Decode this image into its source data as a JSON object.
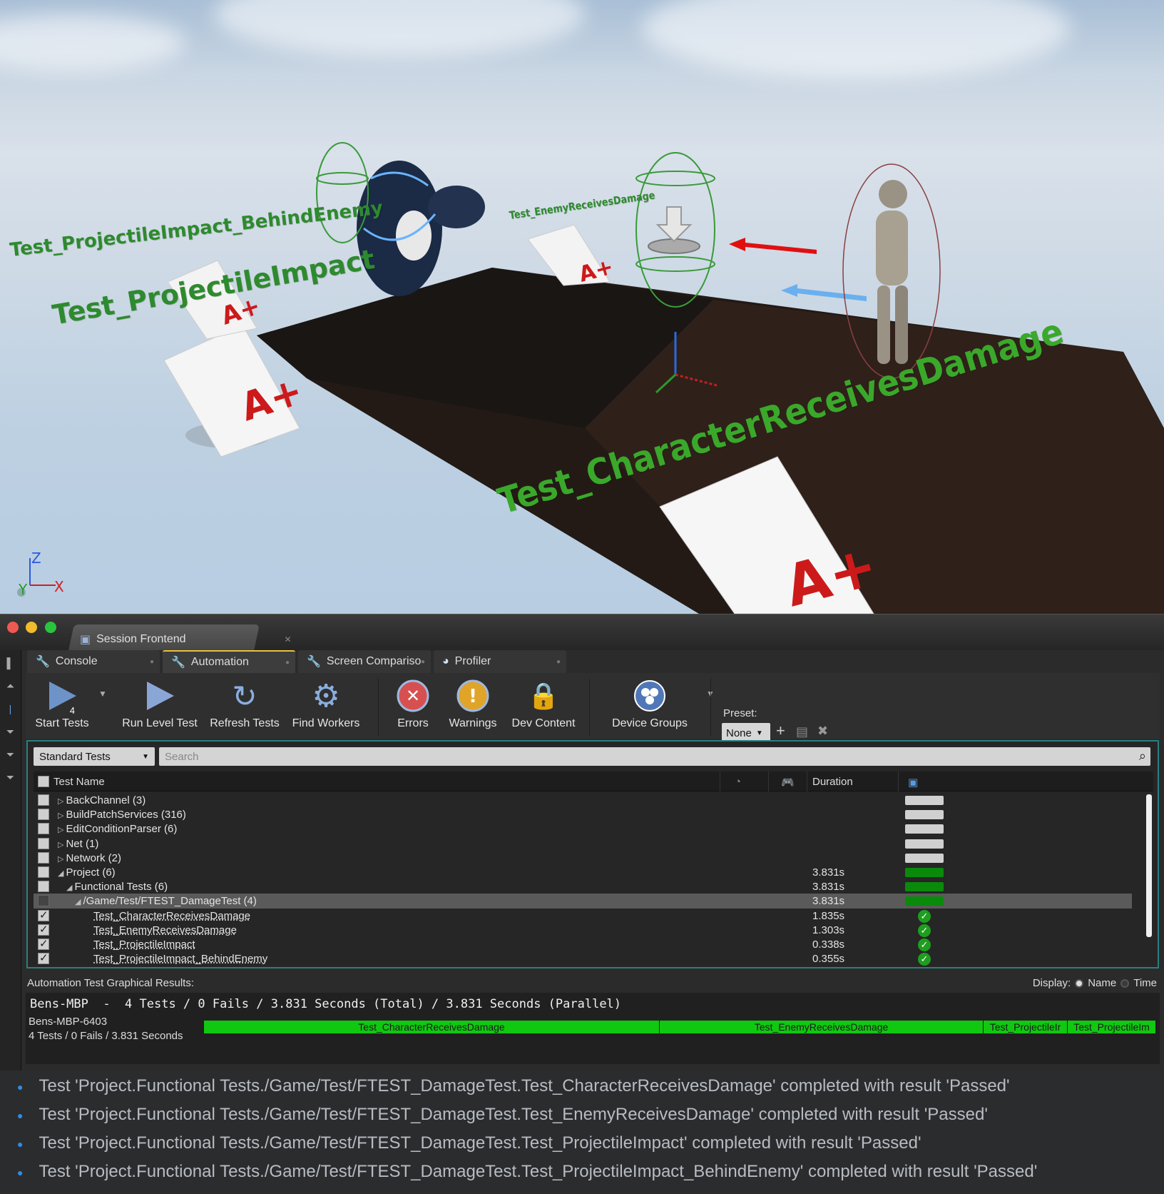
{
  "viewport": {
    "world_labels": [
      "Test_ProjectileImpact_BehindEnemy",
      "Test_ProjectileImpact",
      "Test_EnemyReceivesDamage",
      "Test_CharacterReceivesDamage"
    ],
    "axis": {
      "z": "Z",
      "y": "Y",
      "x": "X"
    }
  },
  "window": {
    "major_tab": "Session Frontend",
    "subtabs": [
      "Console",
      "Automation",
      "Screen Compariso",
      "Profiler"
    ],
    "toolbar": {
      "start_tests": "Start Tests",
      "start_count": "4",
      "run_level_test": "Run Level Test",
      "refresh_tests": "Refresh Tests",
      "find_workers": "Find Workers",
      "errors": "Errors",
      "warnings": "Warnings",
      "dev_content": "Dev Content",
      "device_groups": "Device Groups",
      "preset_label": "Preset:",
      "preset_value": "None"
    },
    "filter": {
      "selected": "Standard Tests",
      "search_placeholder": "Search"
    },
    "columns": {
      "name": "Test Name",
      "duration": "Duration"
    },
    "rows": [
      {
        "name": "BackChannel (3)",
        "duration": "",
        "status": "grey",
        "expander": "closed",
        "indent": 0
      },
      {
        "name": "BuildPatchServices (316)",
        "duration": "",
        "status": "grey",
        "expander": "closed",
        "indent": 0
      },
      {
        "name": "EditConditionParser (6)",
        "duration": "",
        "status": "grey",
        "expander": "closed",
        "indent": 0
      },
      {
        "name": "Net (1)",
        "duration": "",
        "status": "grey",
        "expander": "closed",
        "indent": 0
      },
      {
        "name": "Network (2)",
        "duration": "",
        "status": "grey",
        "expander": "closed",
        "indent": 0
      },
      {
        "name": "Project (6)",
        "duration": "3.831s",
        "status": "green",
        "expander": "open",
        "indent": 0
      },
      {
        "name": "Functional Tests (6)",
        "duration": "3.831s",
        "status": "green",
        "expander": "open",
        "indent": 1
      },
      {
        "name": "/Game/Test/FTEST_DamageTest (4)",
        "duration": "3.831s",
        "status": "green",
        "expander": "open",
        "indent": 2,
        "selected": true
      },
      {
        "name": "Test_CharacterReceivesDamage",
        "duration": "1.835s",
        "status": "ok",
        "indent": 3,
        "checked": true
      },
      {
        "name": "Test_EnemyReceivesDamage",
        "duration": "1.303s",
        "status": "ok",
        "indent": 3,
        "checked": true
      },
      {
        "name": "Test_ProjectileImpact",
        "duration": "0.338s",
        "status": "ok",
        "indent": 3,
        "checked": true
      },
      {
        "name": "Test_ProjectileImpact_BehindEnemy",
        "duration": "0.355s",
        "status": "ok",
        "indent": 3,
        "checked": true
      }
    ],
    "graphical": {
      "label": "Automation Test Graphical Results:",
      "display_label": "Display:",
      "display_name": "Name",
      "display_time": "Time",
      "summary": "Bens-MBP  -  4 Tests / 0 Fails / 3.831 Seconds (Total) / 3.831 Seconds (Parallel)",
      "device": "Bens-MBP-6403",
      "device_summary": "4 Tests / 0 Fails / 3.831 Seconds",
      "bars": [
        {
          "label": "Test_CharacterReceivesDamage",
          "seconds": 1.835
        },
        {
          "label": "Test_EnemyReceivesDamage",
          "seconds": 1.303
        },
        {
          "label": "Test_ProjectileImpact",
          "seconds": 0.338
        },
        {
          "label": "Test_ProjectileImpact_BehindEnemy",
          "seconds": 0.355
        }
      ],
      "bar_labels_visible": [
        "Test_CharacterReceivesDamage",
        "Test_EnemyReceivesDamage",
        "Test_ProjectileIr",
        "Test_ProjectileIm"
      ]
    }
  },
  "log": [
    "Test 'Project.Functional Tests./Game/Test/FTEST_DamageTest.Test_CharacterReceivesDamage' completed with result 'Passed'",
    "Test 'Project.Functional Tests./Game/Test/FTEST_DamageTest.Test_EnemyReceivesDamage' completed with result 'Passed'",
    "Test 'Project.Functional Tests./Game/Test/FTEST_DamageTest.Test_ProjectileImpact' completed with result 'Passed'",
    "Test 'Project.Functional Tests./Game/Test/FTEST_DamageTest.Test_ProjectileImpact_BehindEnemy' completed with result 'Passed'"
  ],
  "colors": {
    "accent_tab": "#e8c23a",
    "panel_border": "#2a7f7f",
    "pass_green": "#11c811",
    "world_label_green": "#2e8a2e"
  }
}
